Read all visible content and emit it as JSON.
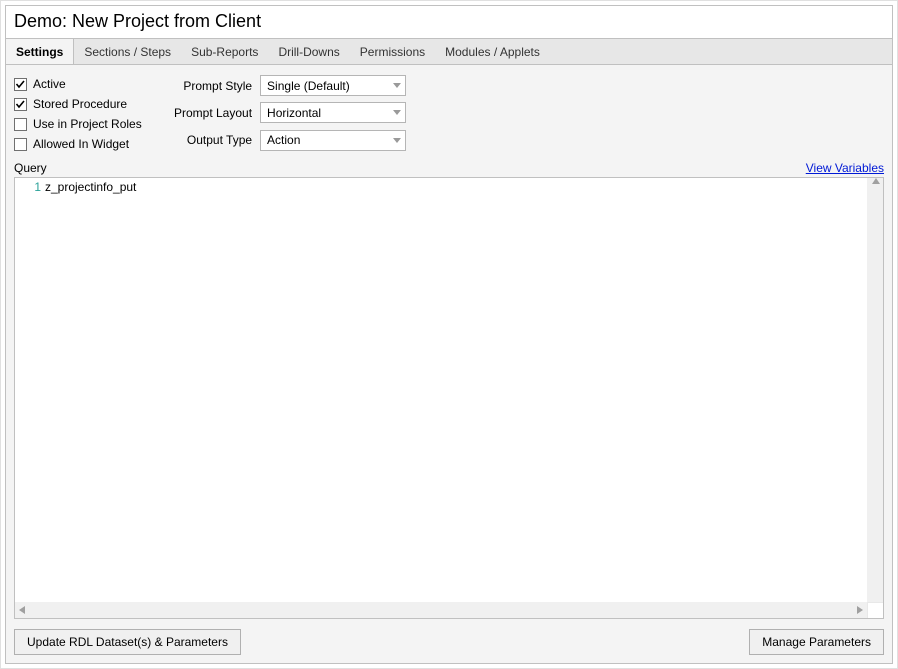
{
  "title": "Demo: New Project from Client",
  "tabs": [
    {
      "label": "Settings",
      "active": true
    },
    {
      "label": "Sections / Steps",
      "active": false
    },
    {
      "label": "Sub-Reports",
      "active": false
    },
    {
      "label": "Drill-Downs",
      "active": false
    },
    {
      "label": "Permissions",
      "active": false
    },
    {
      "label": "Modules / Applets",
      "active": false
    }
  ],
  "checkboxes": {
    "active": {
      "label": "Active",
      "checked": true
    },
    "stored_procedure": {
      "label": "Stored Procedure",
      "checked": true
    },
    "use_in_project_roles": {
      "label": "Use in Project Roles",
      "checked": false
    },
    "allowed_in_widget": {
      "label": "Allowed In Widget",
      "checked": false
    }
  },
  "fields": {
    "prompt_style": {
      "label": "Prompt Style",
      "value": "Single (Default)"
    },
    "prompt_layout": {
      "label": "Prompt Layout",
      "value": "Horizontal"
    },
    "output_type": {
      "label": "Output Type",
      "value": "Action"
    }
  },
  "query": {
    "label": "Query",
    "view_variables": "View Variables",
    "line_number": "1",
    "code": "z_projectinfo_put"
  },
  "buttons": {
    "update_rdl": "Update RDL Dataset(s) & Parameters",
    "manage_parameters": "Manage Parameters"
  }
}
